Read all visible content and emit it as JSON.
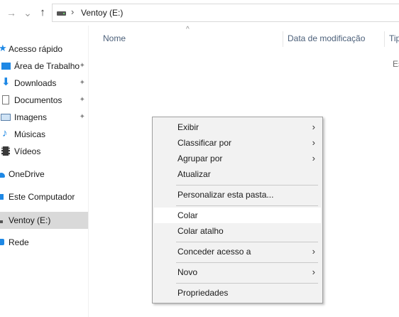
{
  "address": {
    "path_separator": "›",
    "current": "Ventoy (E:)"
  },
  "nav": {
    "forward": "→",
    "recent": "⌄",
    "up": "↑"
  },
  "columns": {
    "name": "Nome",
    "modified": "Data de modificação",
    "type": "Tip",
    "sort_glyph": "^"
  },
  "content": {
    "partial_text": "Es"
  },
  "sidebar": {
    "items": [
      {
        "label": "Acesso rápido",
        "icon": "star-icon"
      },
      {
        "label": "Área de Trabalho",
        "icon": "desktop-icon",
        "pinned": true
      },
      {
        "label": "Downloads",
        "icon": "download-arrow-icon",
        "pinned": true
      },
      {
        "label": "Documentos",
        "icon": "document-icon",
        "pinned": true
      },
      {
        "label": "Imagens",
        "icon": "image-icon",
        "pinned": true
      },
      {
        "label": "Músicas",
        "icon": "music-note-icon"
      },
      {
        "label": "Vídeos",
        "icon": "film-icon"
      },
      {
        "label": "OneDrive",
        "icon": "cloud-icon"
      },
      {
        "label": "Este Computador",
        "icon": "computer-icon"
      },
      {
        "label": "Ventoy (E:)",
        "icon": "drive-icon",
        "selected": true
      },
      {
        "label": "Rede",
        "icon": "network-icon"
      }
    ],
    "pin_glyph": "📌"
  },
  "context_menu": {
    "items": [
      {
        "label": "Exibir",
        "submenu": true
      },
      {
        "label": "Classificar por",
        "submenu": true
      },
      {
        "label": "Agrupar por",
        "submenu": true
      },
      {
        "label": "Atualizar"
      },
      {
        "label": "Personalizar esta pasta..."
      },
      {
        "label": "Colar",
        "hover": true
      },
      {
        "label": "Colar atalho"
      },
      {
        "label": "Conceder acesso a",
        "submenu": true
      },
      {
        "label": "Novo",
        "submenu": true
      },
      {
        "label": "Propriedades"
      }
    ],
    "arrow_glyph": "›"
  },
  "colors": {
    "selection": "#d9d9d9",
    "menu_bg": "#f2f2f2",
    "menu_hover": "#ffffff",
    "header_text": "#4c607a",
    "accent_blue": "#1e88e5"
  }
}
